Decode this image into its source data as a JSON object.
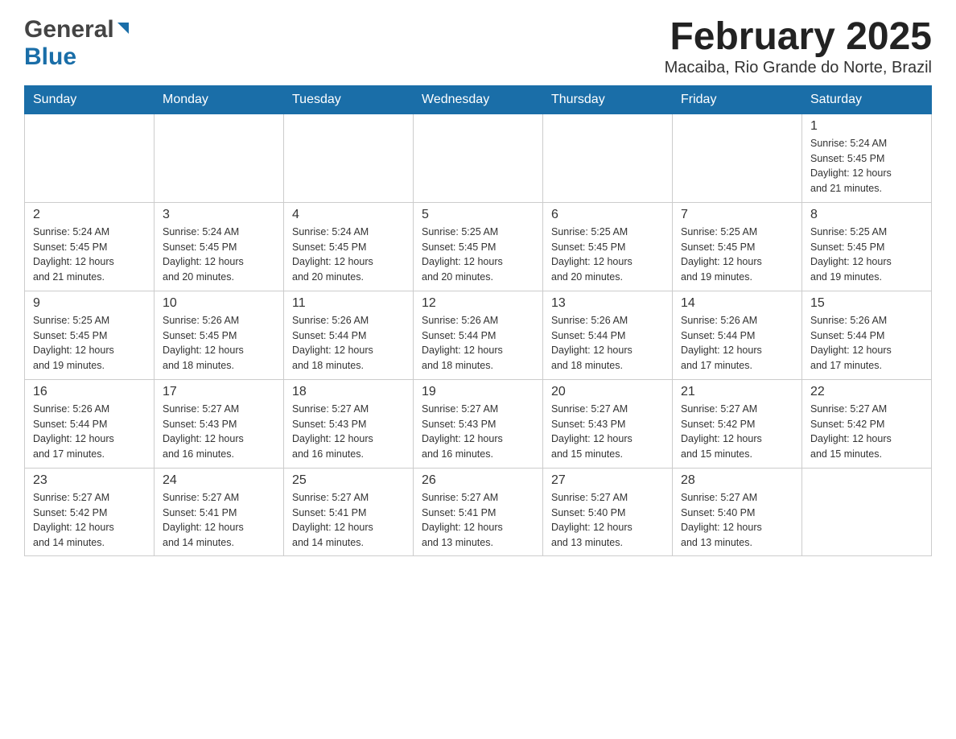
{
  "header": {
    "logo_general": "General",
    "logo_blue": "Blue",
    "title": "February 2025",
    "subtitle": "Macaiba, Rio Grande do Norte, Brazil"
  },
  "days_of_week": [
    "Sunday",
    "Monday",
    "Tuesday",
    "Wednesday",
    "Thursday",
    "Friday",
    "Saturday"
  ],
  "weeks": [
    {
      "days": [
        {
          "num": "",
          "info": ""
        },
        {
          "num": "",
          "info": ""
        },
        {
          "num": "",
          "info": ""
        },
        {
          "num": "",
          "info": ""
        },
        {
          "num": "",
          "info": ""
        },
        {
          "num": "",
          "info": ""
        },
        {
          "num": "1",
          "info": "Sunrise: 5:24 AM\nSunset: 5:45 PM\nDaylight: 12 hours\nand 21 minutes."
        }
      ]
    },
    {
      "days": [
        {
          "num": "2",
          "info": "Sunrise: 5:24 AM\nSunset: 5:45 PM\nDaylight: 12 hours\nand 21 minutes."
        },
        {
          "num": "3",
          "info": "Sunrise: 5:24 AM\nSunset: 5:45 PM\nDaylight: 12 hours\nand 20 minutes."
        },
        {
          "num": "4",
          "info": "Sunrise: 5:24 AM\nSunset: 5:45 PM\nDaylight: 12 hours\nand 20 minutes."
        },
        {
          "num": "5",
          "info": "Sunrise: 5:25 AM\nSunset: 5:45 PM\nDaylight: 12 hours\nand 20 minutes."
        },
        {
          "num": "6",
          "info": "Sunrise: 5:25 AM\nSunset: 5:45 PM\nDaylight: 12 hours\nand 20 minutes."
        },
        {
          "num": "7",
          "info": "Sunrise: 5:25 AM\nSunset: 5:45 PM\nDaylight: 12 hours\nand 19 minutes."
        },
        {
          "num": "8",
          "info": "Sunrise: 5:25 AM\nSunset: 5:45 PM\nDaylight: 12 hours\nand 19 minutes."
        }
      ]
    },
    {
      "days": [
        {
          "num": "9",
          "info": "Sunrise: 5:25 AM\nSunset: 5:45 PM\nDaylight: 12 hours\nand 19 minutes."
        },
        {
          "num": "10",
          "info": "Sunrise: 5:26 AM\nSunset: 5:45 PM\nDaylight: 12 hours\nand 18 minutes."
        },
        {
          "num": "11",
          "info": "Sunrise: 5:26 AM\nSunset: 5:44 PM\nDaylight: 12 hours\nand 18 minutes."
        },
        {
          "num": "12",
          "info": "Sunrise: 5:26 AM\nSunset: 5:44 PM\nDaylight: 12 hours\nand 18 minutes."
        },
        {
          "num": "13",
          "info": "Sunrise: 5:26 AM\nSunset: 5:44 PM\nDaylight: 12 hours\nand 18 minutes."
        },
        {
          "num": "14",
          "info": "Sunrise: 5:26 AM\nSunset: 5:44 PM\nDaylight: 12 hours\nand 17 minutes."
        },
        {
          "num": "15",
          "info": "Sunrise: 5:26 AM\nSunset: 5:44 PM\nDaylight: 12 hours\nand 17 minutes."
        }
      ]
    },
    {
      "days": [
        {
          "num": "16",
          "info": "Sunrise: 5:26 AM\nSunset: 5:44 PM\nDaylight: 12 hours\nand 17 minutes."
        },
        {
          "num": "17",
          "info": "Sunrise: 5:27 AM\nSunset: 5:43 PM\nDaylight: 12 hours\nand 16 minutes."
        },
        {
          "num": "18",
          "info": "Sunrise: 5:27 AM\nSunset: 5:43 PM\nDaylight: 12 hours\nand 16 minutes."
        },
        {
          "num": "19",
          "info": "Sunrise: 5:27 AM\nSunset: 5:43 PM\nDaylight: 12 hours\nand 16 minutes."
        },
        {
          "num": "20",
          "info": "Sunrise: 5:27 AM\nSunset: 5:43 PM\nDaylight: 12 hours\nand 15 minutes."
        },
        {
          "num": "21",
          "info": "Sunrise: 5:27 AM\nSunset: 5:42 PM\nDaylight: 12 hours\nand 15 minutes."
        },
        {
          "num": "22",
          "info": "Sunrise: 5:27 AM\nSunset: 5:42 PM\nDaylight: 12 hours\nand 15 minutes."
        }
      ]
    },
    {
      "days": [
        {
          "num": "23",
          "info": "Sunrise: 5:27 AM\nSunset: 5:42 PM\nDaylight: 12 hours\nand 14 minutes."
        },
        {
          "num": "24",
          "info": "Sunrise: 5:27 AM\nSunset: 5:41 PM\nDaylight: 12 hours\nand 14 minutes."
        },
        {
          "num": "25",
          "info": "Sunrise: 5:27 AM\nSunset: 5:41 PM\nDaylight: 12 hours\nand 14 minutes."
        },
        {
          "num": "26",
          "info": "Sunrise: 5:27 AM\nSunset: 5:41 PM\nDaylight: 12 hours\nand 13 minutes."
        },
        {
          "num": "27",
          "info": "Sunrise: 5:27 AM\nSunset: 5:40 PM\nDaylight: 12 hours\nand 13 minutes."
        },
        {
          "num": "28",
          "info": "Sunrise: 5:27 AM\nSunset: 5:40 PM\nDaylight: 12 hours\nand 13 minutes."
        },
        {
          "num": "",
          "info": ""
        }
      ]
    }
  ]
}
